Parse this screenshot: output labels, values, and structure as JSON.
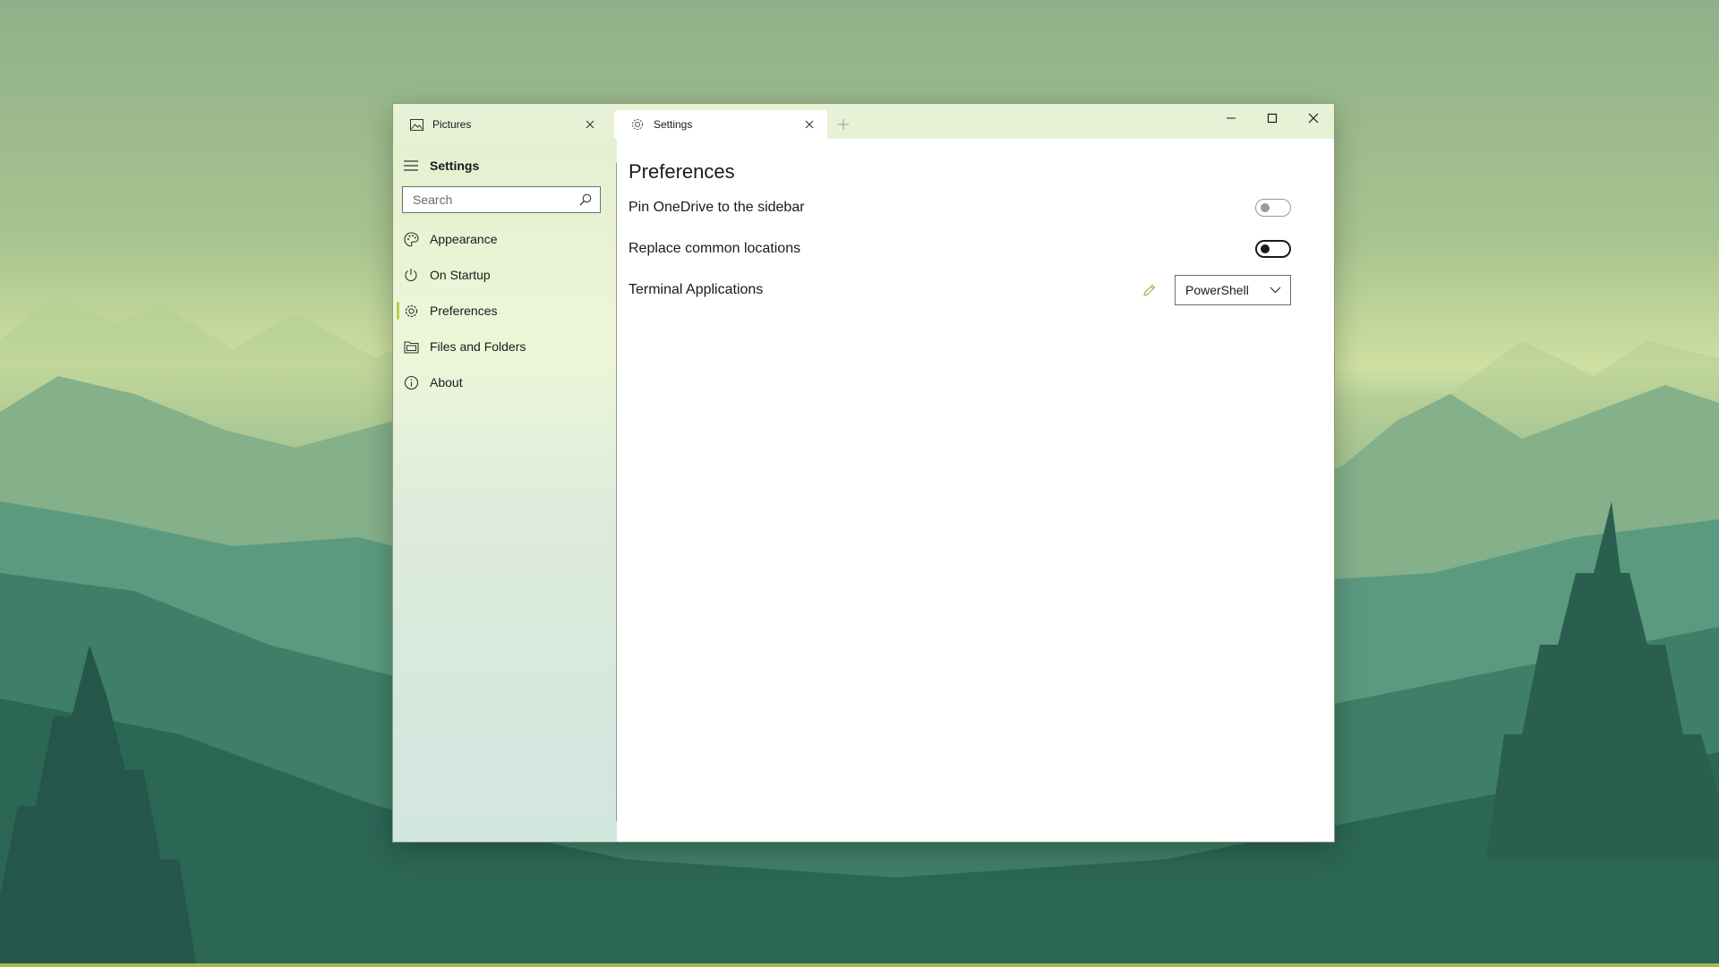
{
  "tabs": [
    {
      "label": "Pictures",
      "icon": "pictures-icon"
    },
    {
      "label": "Settings",
      "icon": "gear-icon"
    }
  ],
  "window_controls": [
    "minimize",
    "maximize",
    "close"
  ],
  "sidebar": {
    "title": "Settings",
    "search": {
      "placeholder": "Search",
      "value": ""
    },
    "items": [
      {
        "label": "Appearance",
        "icon": "palette-icon"
      },
      {
        "label": "On Startup",
        "icon": "power-icon"
      },
      {
        "label": "Preferences",
        "icon": "gear-icon",
        "selected": true
      },
      {
        "label": "Files and Folders",
        "icon": "folder-icon"
      },
      {
        "label": "About",
        "icon": "info-icon"
      }
    ]
  },
  "content": {
    "title": "Preferences",
    "settings": [
      {
        "label": "Pin OneDrive to the sidebar",
        "type": "toggle",
        "value": "off"
      },
      {
        "label": "Replace common locations",
        "type": "toggle",
        "value": "off"
      },
      {
        "label": "Terminal Applications",
        "type": "select",
        "value": "PowerShell"
      }
    ]
  },
  "colors": {
    "accent": "#b5cc55",
    "titlebar": "#e7f1d6",
    "sidebar_top": "#e4f0d0",
    "sidebar_bottom": "#d2e6e0"
  }
}
